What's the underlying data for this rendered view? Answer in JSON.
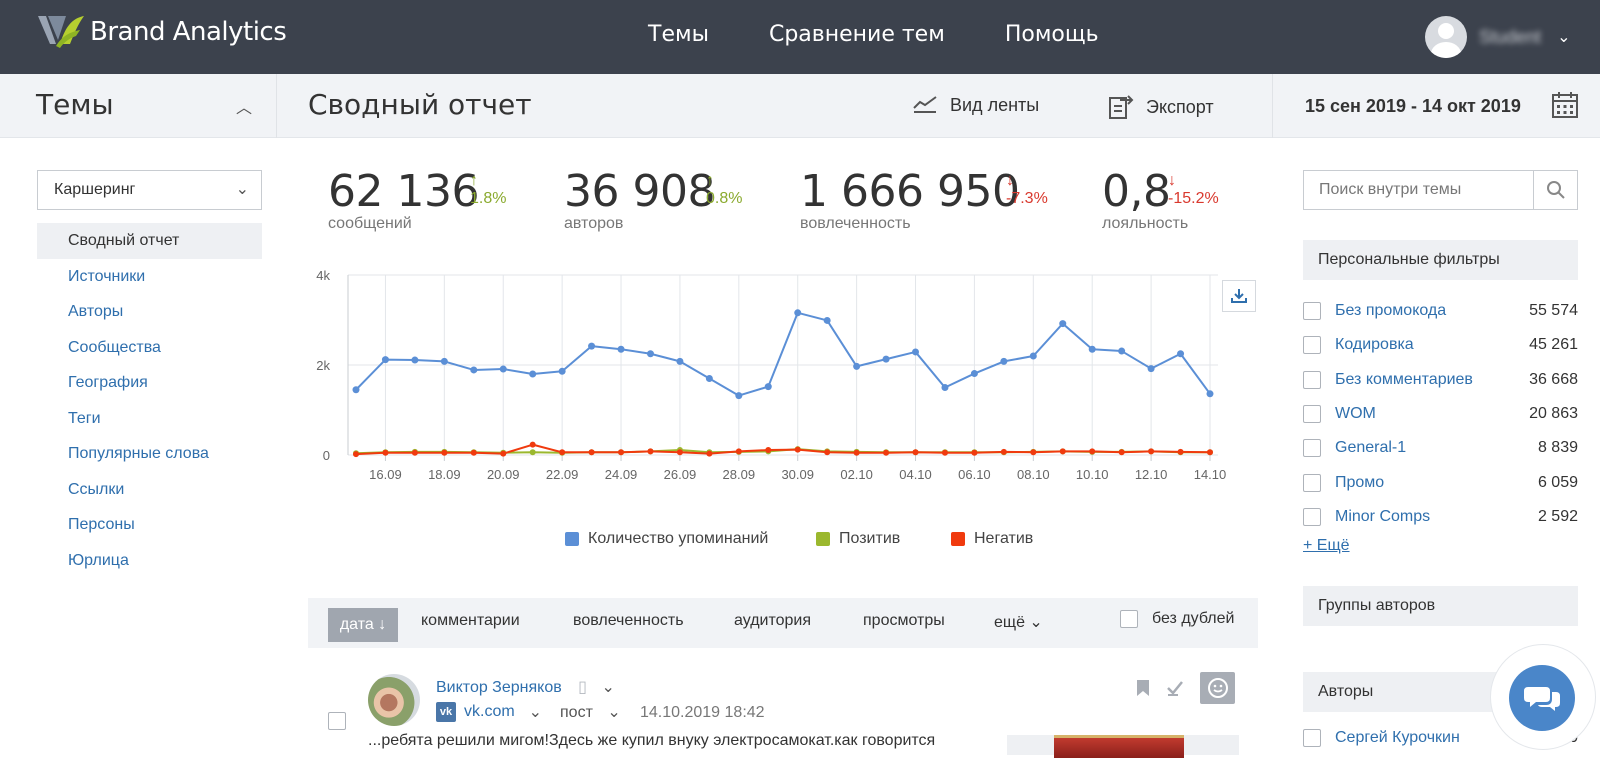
{
  "app": {
    "name": "Brand Analytics"
  },
  "nav": {
    "items": [
      "Темы",
      "Сравнение тем",
      "Помощь"
    ]
  },
  "user": {
    "name": "Student"
  },
  "subheader": {
    "left_title": "Темы",
    "page_title": "Сводный отчет",
    "feed_view": "Вид ленты",
    "export": "Экспорт",
    "date_range": "15 сен 2019 - 14 окт 2019"
  },
  "sidebar": {
    "theme_select": "Каршеринг",
    "items": [
      {
        "label": "Сводный отчет",
        "active": true
      },
      {
        "label": "Источники"
      },
      {
        "label": "Авторы"
      },
      {
        "label": "Сообщества"
      },
      {
        "label": "География"
      },
      {
        "label": "Теги"
      },
      {
        "label": "Популярные слова"
      },
      {
        "label": "Ссылки"
      },
      {
        "label": "Персоны"
      },
      {
        "label": "Юрлица"
      }
    ]
  },
  "kpis": [
    {
      "value": "62 136",
      "delta": "↑ 1.8%",
      "trend": "up",
      "label": "сообщений"
    },
    {
      "value": "36 908",
      "delta": "↑ 0.8%",
      "trend": "up",
      "label": "авторов"
    },
    {
      "value": "1 666 950",
      "delta": "↓ -7.3%",
      "trend": "down",
      "label": "вовлеченность"
    },
    {
      "value": "0,8",
      "delta": "↓ -15.2%",
      "trend": "down",
      "label": "лояльность"
    }
  ],
  "chart_data": {
    "type": "line",
    "x": [
      "15.09",
      "16.09",
      "17.09",
      "18.09",
      "19.09",
      "20.09",
      "21.09",
      "22.09",
      "23.09",
      "24.09",
      "25.09",
      "26.09",
      "27.09",
      "28.09",
      "29.09",
      "30.09",
      "01.10",
      "02.10",
      "03.10",
      "04.10",
      "05.10",
      "06.10",
      "07.10",
      "08.10",
      "09.10",
      "10.10",
      "11.10",
      "12.10",
      "13.10",
      "14.10"
    ],
    "tick_labels": [
      "16.09",
      "18.09",
      "20.09",
      "22.09",
      "24.09",
      "26.09",
      "28.09",
      "30.09",
      "02.10",
      "04.10",
      "06.10",
      "08.10",
      "10.10",
      "12.10",
      "14.10"
    ],
    "y_ticks": [
      "4k",
      "2k",
      "0"
    ],
    "ylim": [
      0,
      4000
    ],
    "series": [
      {
        "name": "Количество упоминаний",
        "color": "#5b8fd6",
        "values": [
          1450,
          2120,
          2110,
          2080,
          1890,
          1910,
          1800,
          1860,
          2420,
          2350,
          2250,
          2080,
          1700,
          1320,
          1520,
          3160,
          2990,
          1970,
          2130,
          2290,
          1500,
          1810,
          2080,
          2200,
          2920,
          2350,
          2310,
          1920,
          2250,
          1360
        ]
      },
      {
        "name": "Позитив",
        "color": "#9bb82e",
        "values": [
          40,
          60,
          70,
          70,
          60,
          50,
          60,
          50,
          60,
          60,
          80,
          110,
          60,
          70,
          80,
          130,
          80,
          70,
          60,
          60,
          60,
          60,
          60,
          70,
          80,
          70,
          70,
          80,
          60,
          60
        ]
      },
      {
        "name": "Негатив",
        "color": "#f03a0e",
        "values": [
          20,
          50,
          50,
          50,
          50,
          30,
          230,
          60,
          60,
          60,
          80,
          60,
          30,
          80,
          110,
          120,
          60,
          50,
          50,
          60,
          50,
          50,
          70,
          60,
          80,
          80,
          60,
          80,
          70,
          60
        ]
      }
    ],
    "legend_placement": "bottom",
    "grid": true
  },
  "sortbar": {
    "active": "дата ↓",
    "items": [
      "комментарии",
      "вовлеченность",
      "аудитория",
      "просмотры",
      "ещё"
    ],
    "no_dupes": "без дублей"
  },
  "post": {
    "author": "Виктор Зерняков",
    "source": "vk.com",
    "vk_badge": "vk",
    "type": "пост",
    "date": "14.10.2019 18:42",
    "text": "...ребята решили мигом!Здесь же купил внуку электросамокат.как говорится"
  },
  "right": {
    "search_placeholder": "Поиск внутри темы",
    "personal_filters_title": "Персональные фильтры",
    "filters": [
      {
        "name": "Без промокода",
        "count": "55 574"
      },
      {
        "name": "Кодировка",
        "count": "45 261"
      },
      {
        "name": "Без комментариев",
        "count": "36 668"
      },
      {
        "name": "WOM",
        "count": "20 863"
      },
      {
        "name": "General-1",
        "count": "8 839"
      },
      {
        "name": "Промо",
        "count": "6 059"
      },
      {
        "name": "Minor Comps",
        "count": "2 592"
      }
    ],
    "more": "+ Ещё",
    "author_groups_title": "Группы авторов",
    "authors_title": "Авторы",
    "authors": [
      {
        "name": "Сергей Курочкин",
        "count": "520"
      }
    ]
  }
}
